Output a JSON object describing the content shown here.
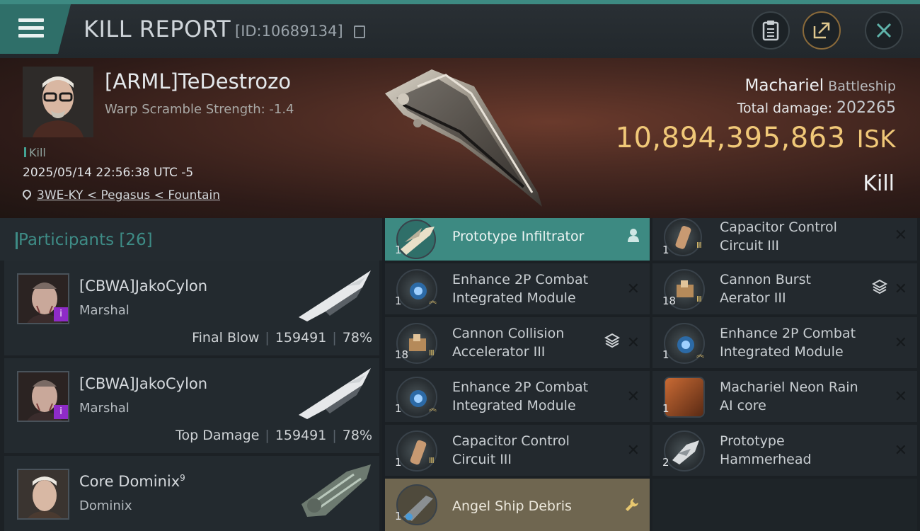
{
  "header": {
    "title": "KILL REPORT",
    "report_id": "[ID:10689134]",
    "buttons": {
      "clipboard": "clipboard-icon",
      "share": "share-icon",
      "close": "close-icon"
    }
  },
  "victim": {
    "name": "[ARML]TeDestrozo",
    "warp_scramble": "Warp Scramble Strength: -1.4",
    "kill_tag": "Kill",
    "datetime": "2025/05/14 22:56:38 UTC -5",
    "location": "3WE-KY < Pegasus < Fountain",
    "ship_name": "Machariel",
    "ship_class": "Battleship",
    "total_damage_label": "Total damage:",
    "total_damage": "202265",
    "isk_value": "10,894,395,863",
    "isk_unit": "ISK",
    "result": "Kill"
  },
  "participants": {
    "title": "Participants",
    "count": "[26]",
    "rows": [
      {
        "name": "[CBWA]JakoCylon",
        "ship": "Marshal",
        "role": "Final Blow",
        "damage": "159491",
        "percent": "78%",
        "badge": "i"
      },
      {
        "name": "[CBWA]JakoCylon",
        "ship": "Marshal",
        "role": "Top Damage",
        "damage": "159491",
        "percent": "78%",
        "badge": "i"
      },
      {
        "name": "Core Dominix",
        "name_sup": "9",
        "ship": "Dominix"
      }
    ]
  },
  "items": [
    {
      "qty": "1",
      "name1": "Prototype  Infiltrator",
      "name2": "",
      "state": "teal"
    },
    {
      "qty": "1",
      "name1": "Capacitor Control",
      "name2": "Circuit III",
      "state": "normal"
    },
    {
      "qty": "1",
      "name1": "Enhance 2P Combat",
      "name2": "Integrated Module",
      "state": "normal"
    },
    {
      "qty": "18",
      "name1": "Cannon Burst",
      "name2": "Aerator III",
      "state": "normal",
      "stack": true
    },
    {
      "qty": "18",
      "name1": "Cannon Collision",
      "name2": "Accelerator III",
      "state": "normal",
      "stack": true
    },
    {
      "qty": "1",
      "name1": "Enhance 2P Combat",
      "name2": "Integrated Module",
      "state": "normal"
    },
    {
      "qty": "1",
      "name1": "Enhance 2P Combat",
      "name2": "Integrated Module",
      "state": "normal"
    },
    {
      "qty": "1",
      "name1": "Machariel Neon Rain",
      "name2": "AI core",
      "state": "normal"
    },
    {
      "qty": "1",
      "name1": "Capacitor Control",
      "name2": "Circuit III",
      "state": "normal"
    },
    {
      "qty": "2",
      "name1": "Prototype",
      "name2": "Hammerhead",
      "state": "normal"
    },
    {
      "qty": "1",
      "name1": "Angel Ship Debris",
      "name2": "",
      "state": "gold"
    }
  ],
  "colors": {
    "accent_teal": "#3d8a82",
    "isk_gold": "#f0c878",
    "badge_purple": "#8e2bc7"
  }
}
